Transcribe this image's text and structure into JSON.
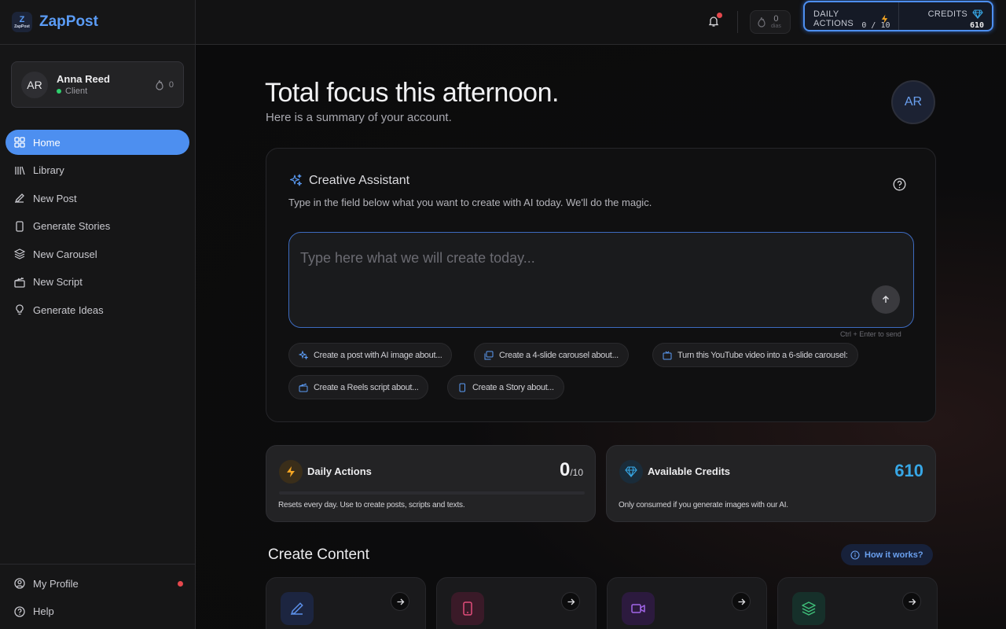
{
  "app": {
    "name": "ZapPost",
    "logo_top": "Z",
    "logo_bottom": "ZapPost"
  },
  "user": {
    "initials": "AR",
    "name": "Anna Reed",
    "role": "Client",
    "streak": "0"
  },
  "nav": {
    "items": [
      {
        "label": "Home",
        "icon": "grid-icon",
        "active": true
      },
      {
        "label": "Library",
        "icon": "library-icon"
      },
      {
        "label": "New Post",
        "icon": "pencil-icon"
      },
      {
        "label": "Generate Stories",
        "icon": "phone-icon"
      },
      {
        "label": "New Carousel",
        "icon": "layers-icon"
      },
      {
        "label": "New Script",
        "icon": "clapperboard-icon"
      },
      {
        "label": "Generate Ideas",
        "icon": "lightbulb-icon"
      }
    ],
    "bottom": [
      {
        "label": "My Profile",
        "icon": "user-circle-icon",
        "notification": true
      },
      {
        "label": "Help",
        "icon": "help-circle-icon"
      }
    ]
  },
  "topbar": {
    "streak_value": "0",
    "streak_label": "dias",
    "daily_actions_label": "DAILY ACTIONS",
    "daily_actions_value": "0 / 10",
    "credits_label": "CREDITS",
    "credits_value": "610"
  },
  "hero": {
    "title": "Total focus this afternoon.",
    "subtitle": "Here is a summary of your account.",
    "avatar_initials": "AR"
  },
  "assistant": {
    "title": "Creative Assistant",
    "subtitle": "Type in the field below what you want to create with AI today. We'll do the magic.",
    "placeholder": "Type here what we will create today...",
    "hint": "Ctrl + Enter to send",
    "suggestions": [
      "Create a post with AI image about...",
      "Create a 4-slide carousel about...",
      "Turn this YouTube video into a 6-slide carousel:",
      "Create a Reels script about...",
      "Create a Story about..."
    ]
  },
  "stats": {
    "daily": {
      "title": "Daily Actions",
      "value": "0",
      "max": "/10",
      "progress": 0,
      "desc": "Resets every day. Use to create posts, scripts and texts."
    },
    "credits": {
      "title": "Available Credits",
      "value": "610",
      "desc": "Only consumed if you generate images with our AI."
    }
  },
  "create": {
    "title": "Create Content",
    "how_label": "How it works?",
    "tiles": [
      {
        "icon": "pencil-icon",
        "color": "#5b8fe8"
      },
      {
        "icon": "phone-icon",
        "color": "#e24d7a"
      },
      {
        "icon": "video-icon",
        "color": "#a266e8"
      },
      {
        "icon": "layers-icon",
        "color": "#3fbf7a"
      }
    ]
  },
  "colors": {
    "accent": "#4d8ff0",
    "credits": "#37a7e6",
    "warning": "#f5a623",
    "online": "#2fcf6d",
    "alert": "#e5484d"
  }
}
